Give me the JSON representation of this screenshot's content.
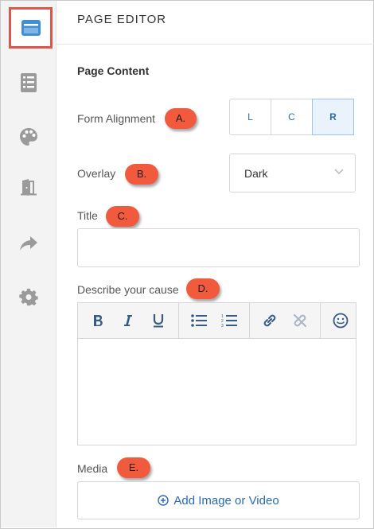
{
  "header": {
    "title": "PAGE EDITOR"
  },
  "sidebar": {
    "items": [
      {
        "icon": "page-layout-icon",
        "active": true
      },
      {
        "icon": "list-icon"
      },
      {
        "icon": "palette-icon"
      },
      {
        "icon": "door-icon"
      },
      {
        "icon": "share-icon"
      },
      {
        "icon": "gear-icon"
      }
    ],
    "active_border_color": "#e0554a",
    "active_icon_color": "#3d8fd8"
  },
  "content": {
    "section_title": "Page Content",
    "form_alignment": {
      "label": "Form Alignment",
      "badge": "A.",
      "options": [
        "L",
        "C",
        "R"
      ],
      "selected": "R"
    },
    "overlay": {
      "label": "Overlay",
      "badge": "B.",
      "value": "Dark"
    },
    "title_field": {
      "label": "Title",
      "badge": "C.",
      "value": ""
    },
    "cause": {
      "label": "Describe your cause",
      "badge": "D.",
      "toolbar": [
        "bold-icon",
        "italic-icon",
        "underline-icon",
        "bullet-list-icon",
        "numbered-list-icon",
        "link-icon",
        "unlink-icon",
        "emoji-icon"
      ]
    },
    "media": {
      "label": "Media",
      "badge": "E.",
      "button_label": "Add Image or Video"
    }
  },
  "colors": {
    "badge": "#f15a3c",
    "link": "#2a6ab2"
  }
}
